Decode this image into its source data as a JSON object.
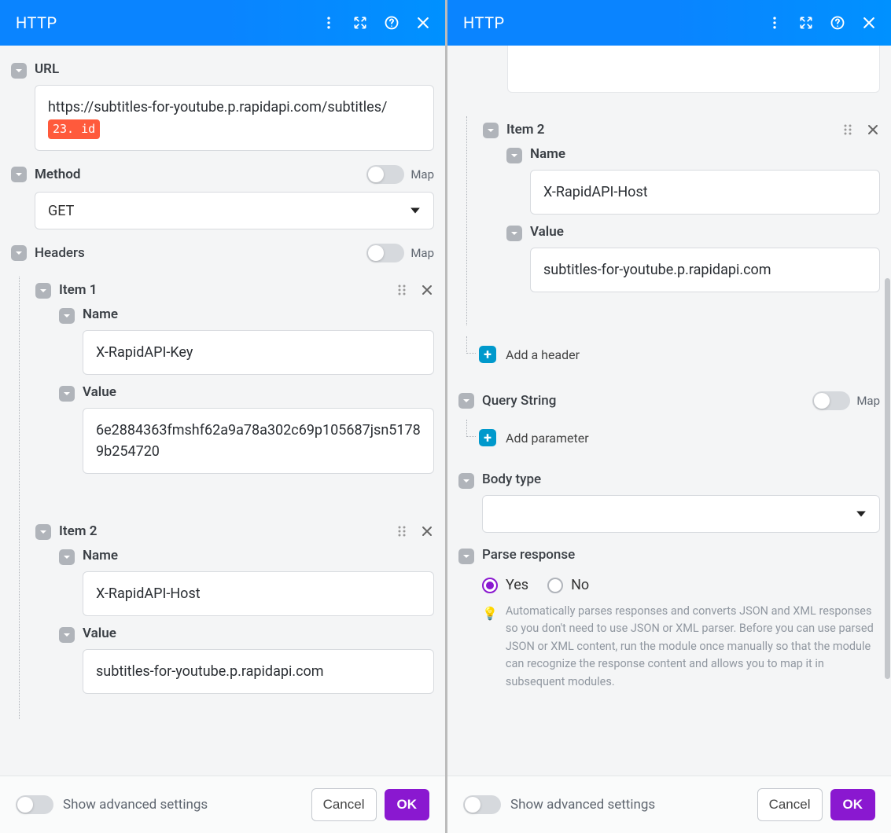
{
  "left": {
    "title": "HTTP",
    "url": {
      "label": "URL",
      "text": "https://subtitles-for-youtube.p.rapidapi.com/subtitles/",
      "chip": "23. id"
    },
    "method": {
      "label": "Method",
      "value": "GET",
      "map": "Map"
    },
    "headers": {
      "label": "Headers",
      "map": "Map",
      "items": [
        {
          "title": "Item 1",
          "name": {
            "label": "Name",
            "value": "X-RapidAPI-Key"
          },
          "value": {
            "label": "Value",
            "value": "6e2884363fmshf62a9a78a302c69p105687jsn51789b254720"
          }
        },
        {
          "title": "Item 2",
          "name": {
            "label": "Name",
            "value": "X-RapidAPI-Host"
          },
          "value": {
            "label": "Value",
            "value": "subtitles-for-youtube.p.rapidapi.com"
          }
        }
      ]
    },
    "footer": {
      "advanced": "Show advanced settings",
      "cancel": "Cancel",
      "ok": "OK"
    }
  },
  "right": {
    "title": "HTTP",
    "headers": {
      "items": [
        {
          "title": "Item 2",
          "name": {
            "label": "Name",
            "value": "X-RapidAPI-Host"
          },
          "value": {
            "label": "Value",
            "value": "subtitles-for-youtube.p.rapidapi.com"
          }
        }
      ],
      "add": "Add a header"
    },
    "query": {
      "label": "Query String",
      "map": "Map",
      "add": "Add parameter"
    },
    "body": {
      "label": "Body type",
      "value": ""
    },
    "parse": {
      "label": "Parse response",
      "yes": "Yes",
      "no": "No",
      "selected": "yes",
      "hint": "Automatically parses responses and converts JSON and XML responses so you don't need to use JSON or XML parser. Before you can use parsed JSON or XML content, run the module once manually so that the module can recognize the response content and allows you to map it in subsequent modules."
    },
    "footer": {
      "advanced": "Show advanced settings",
      "cancel": "Cancel",
      "ok": "OK"
    }
  }
}
